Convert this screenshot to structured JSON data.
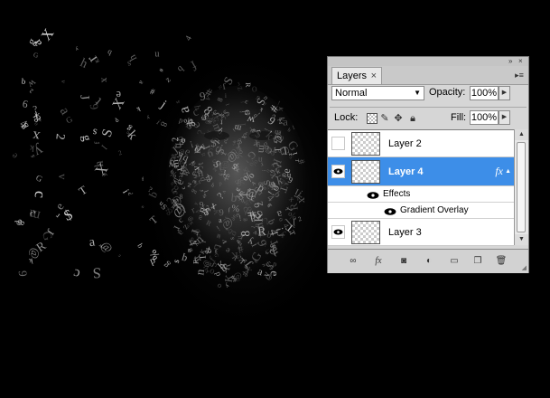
{
  "panel": {
    "tab_label": "Layers",
    "tab_close": "×",
    "blend_mode": "Normal",
    "opacity_label": "Opacity:",
    "opacity_value": "100%",
    "lock_label": "Lock:",
    "fill_label": "Fill:",
    "fill_value": "100%"
  },
  "layers": [
    {
      "name": "Layer 2",
      "visible": false,
      "selected": false
    },
    {
      "name": "Layer 4",
      "visible": true,
      "selected": true,
      "fx": "fx"
    },
    {
      "name": "Layer 3",
      "visible": true,
      "selected": false
    }
  ],
  "effects": {
    "header": "Effects",
    "items": [
      "Gradient Overlay"
    ]
  },
  "colors": {
    "selection": "#3d8ee8",
    "background": "#000000"
  }
}
